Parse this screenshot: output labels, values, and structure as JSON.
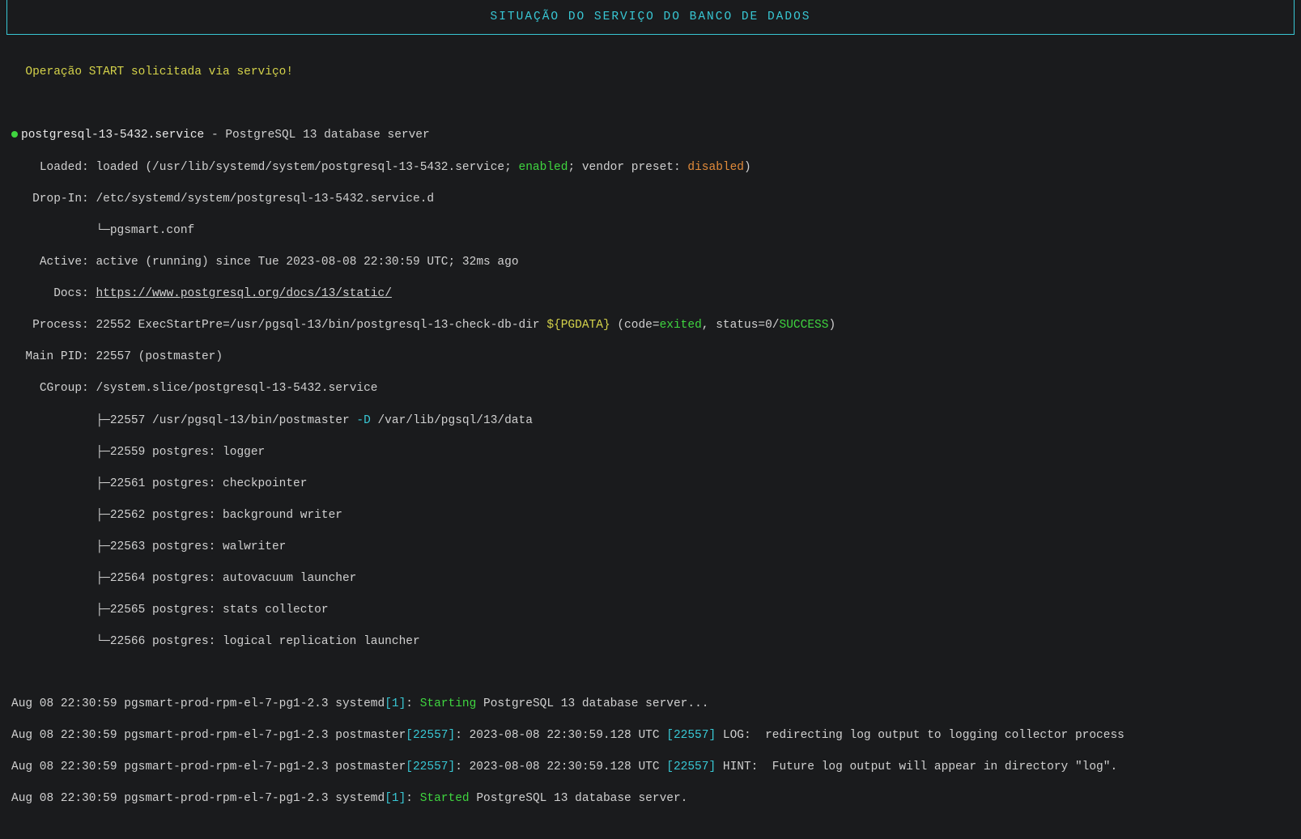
{
  "header": {
    "title": "SITUAÇÃO DO SERVIÇO DO BANCO DE DADOS"
  },
  "op_msg": "Operação START solicitada via serviço!",
  "service": {
    "name": "postgresql-13-5432.service",
    "desc": "PostgreSQL 13 database server",
    "loaded_label": "Loaded:",
    "loaded_prefix": "loaded (/usr/lib/systemd/system/postgresql-13-5432.service; ",
    "loaded_enabled": "enabled",
    "loaded_mid": "; vendor preset: ",
    "loaded_disabled": "disabled",
    "loaded_suffix": ")",
    "dropin_label": "Drop-In:",
    "dropin_path": "/etc/systemd/system/postgresql-13-5432.service.d",
    "dropin_file": "└─pgsmart.conf",
    "active_label": "Active:",
    "active_value": "active (running) since Tue 2023-08-08 22:30:59 UTC; 32ms ago",
    "docs_label": "Docs:",
    "docs_url": "https://www.postgresql.org/docs/13/static/",
    "process_label": "Process:",
    "process_pre": "22552 ExecStartPre=/usr/pgsql-13/bin/postgresql-13-check-db-dir ",
    "process_var": "${PGDATA}",
    "process_code_prefix": " (code=",
    "process_code": "exited",
    "process_status_prefix": ", status=0/",
    "process_status": "SUCCESS",
    "process_suffix": ")",
    "mainpid_label": "Main PID:",
    "mainpid_value": "22557 (postmaster)",
    "cgroup_label": "CGroup:",
    "cgroup_path": "/system.slice/postgresql-13-5432.service",
    "tree": {
      "l1_prefix": "├─22557 /usr/pgsql-13/bin/postmaster ",
      "l1_flag": "-D",
      "l1_path": " /var/lib/pgsql/13/data",
      "l2": "├─22559 postgres: logger",
      "l3": "├─22561 postgres: checkpointer",
      "l4": "├─22562 postgres: background writer",
      "l5": "├─22563 postgres: walwriter",
      "l6": "├─22564 postgres: autovacuum launcher",
      "l7": "├─22565 postgres: stats collector",
      "l8": "└─22566 postgres: logical replication launcher"
    }
  },
  "logs": {
    "l1_ts": "Aug 08 22:30:59 pgsmart-prod-rpm-el-7-pg1-2.3 systemd",
    "l1_pid": "[1]",
    "l1_colon": ": ",
    "l1_action": "Starting",
    "l1_rest": " PostgreSQL 13 database server...",
    "l2_ts": "Aug 08 22:30:59 pgsmart-prod-rpm-el-7-pg1-2.3 postmaster",
    "l2_pid": "[22557]",
    "l2_mid": ": 2023-08-08 22:30:59.128 UTC ",
    "l2_pid2": "[22557]",
    "l2_rest": " LOG:  redirecting log output to logging collector process",
    "l3_ts": "Aug 08 22:30:59 pgsmart-prod-rpm-el-7-pg1-2.3 postmaster",
    "l3_pid": "[22557]",
    "l3_mid": ": 2023-08-08 22:30:59.128 UTC ",
    "l3_pid2": "[22557]",
    "l3_rest": " HINT:  Future log output will appear in directory \"log\".",
    "l4_ts": "Aug 08 22:30:59 pgsmart-prod-rpm-el-7-pg1-2.3 systemd",
    "l4_pid": "[1]",
    "l4_colon": ": ",
    "l4_action": "Started",
    "l4_rest": " PostgreSQL 13 database server."
  }
}
